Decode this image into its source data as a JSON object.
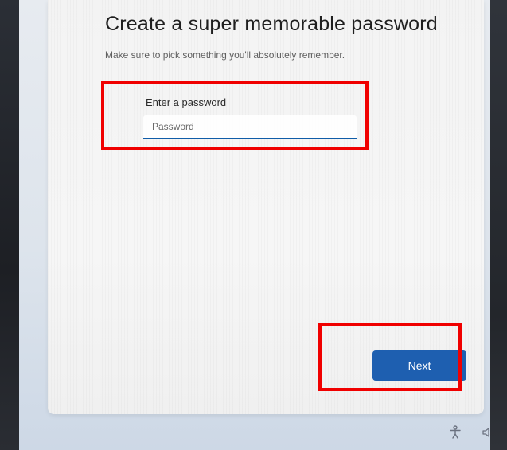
{
  "dialog": {
    "title": "Create a super memorable password",
    "subtitle": "Make sure to pick something you'll absolutely remember.",
    "field_label": "Enter a password",
    "password_placeholder": "Password",
    "password_value": "",
    "next_label": "Next"
  },
  "taskbar": {
    "icons": [
      "accessibility-icon",
      "volume-icon"
    ]
  },
  "colors": {
    "accent": "#1e5fb0",
    "highlight": "#f00000",
    "dialog_background": "#f3f3f3"
  }
}
